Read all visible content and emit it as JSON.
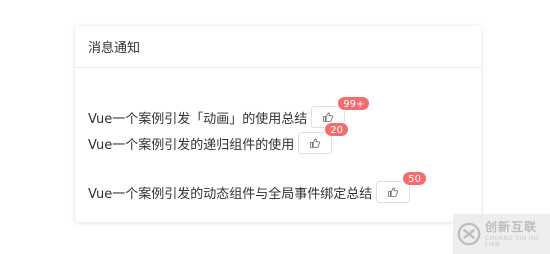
{
  "card": {
    "title": "消息通知",
    "messages": [
      {
        "text": "Vue一个案例引发「动画」的使用总结",
        "badge": "99+"
      },
      {
        "text": "Vue一个案例引发的递归组件的使用",
        "badge": "20"
      },
      {
        "text": "Vue一个案例引发的动态组件与全局事件绑定总结",
        "badge": "50"
      }
    ],
    "like_icon": "thumbs-up-icon"
  },
  "watermark": {
    "name": "创新互联",
    "sub": "CHUANG XIN HU LIAN",
    "logo_icon": "brand-logo-icon"
  },
  "colors": {
    "badge": "#f56c6c",
    "text": "#303133",
    "border": "#dcdfe6"
  }
}
